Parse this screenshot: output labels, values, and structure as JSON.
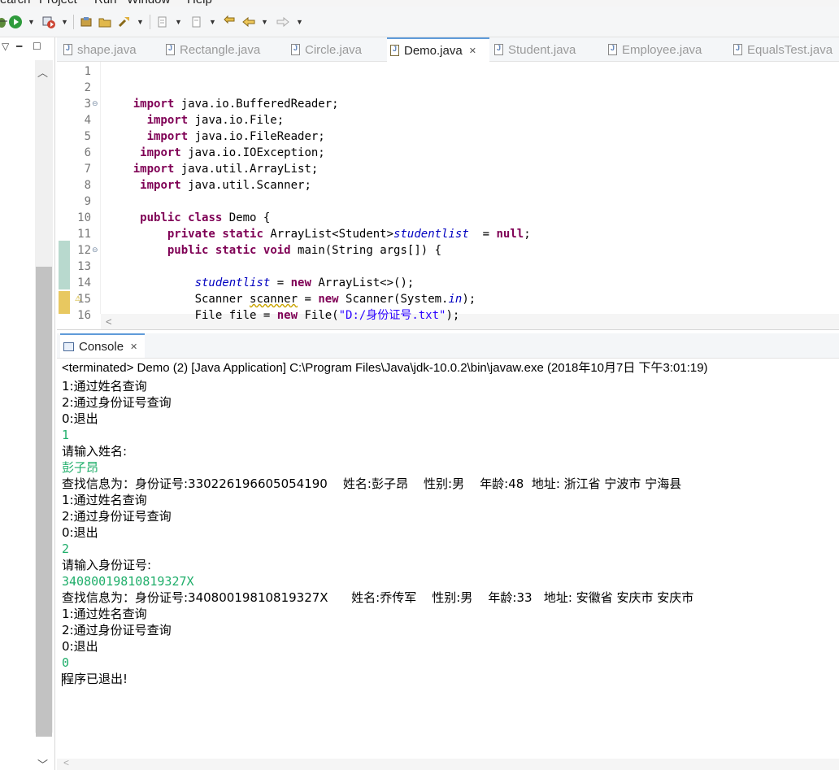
{
  "menubar": {
    "items": [
      "earch",
      "Project",
      "Run",
      "Window",
      "Help"
    ]
  },
  "tabs": [
    {
      "label": "shape.java",
      "active": false
    },
    {
      "label": "Rectangle.java",
      "active": false
    },
    {
      "label": "Circle.java",
      "active": false
    },
    {
      "label": "Demo.java",
      "active": true
    },
    {
      "label": "Student.java",
      "active": false
    },
    {
      "label": "Employee.java",
      "active": false
    },
    {
      "label": "EqualsTest.java",
      "active": false
    }
  ],
  "editor": {
    "line_numbers": [
      "1",
      "2",
      "3",
      "4",
      "5",
      "6",
      "7",
      "8",
      "9",
      "10",
      "11",
      "12",
      "13",
      "14",
      "15",
      "16"
    ],
    "lines": [
      {
        "indent": "",
        "parts": []
      },
      {
        "indent": "",
        "parts": []
      },
      {
        "indent": "    ",
        "parts": [
          {
            "t": "import",
            "c": "kw"
          },
          {
            "t": " java.io.BufferedReader;"
          }
        ]
      },
      {
        "indent": "      ",
        "parts": [
          {
            "t": "import",
            "c": "kw"
          },
          {
            "t": " java.io.File;"
          }
        ]
      },
      {
        "indent": "      ",
        "parts": [
          {
            "t": "import",
            "c": "kw"
          },
          {
            "t": " java.io.FileReader;"
          }
        ]
      },
      {
        "indent": "     ",
        "parts": [
          {
            "t": "import",
            "c": "kw"
          },
          {
            "t": " java.io.IOException;"
          }
        ]
      },
      {
        "indent": "    ",
        "parts": [
          {
            "t": "import",
            "c": "kw"
          },
          {
            "t": " java.util.ArrayList;"
          }
        ]
      },
      {
        "indent": "     ",
        "parts": [
          {
            "t": "import",
            "c": "kw"
          },
          {
            "t": " java.util.Scanner;"
          }
        ]
      },
      {
        "indent": "",
        "parts": []
      },
      {
        "indent": "     ",
        "parts": [
          {
            "t": "public",
            "c": "kw"
          },
          {
            "t": " "
          },
          {
            "t": "class",
            "c": "kw"
          },
          {
            "t": " Demo {"
          }
        ]
      },
      {
        "indent": "         ",
        "parts": [
          {
            "t": "private",
            "c": "kw"
          },
          {
            "t": " "
          },
          {
            "t": "static",
            "c": "kw"
          },
          {
            "t": " ArrayList<Student>"
          },
          {
            "t": "studentlist",
            "c": "fld"
          },
          {
            "t": "  = "
          },
          {
            "t": "null",
            "c": "kw"
          },
          {
            "t": ";"
          }
        ]
      },
      {
        "indent": "         ",
        "parts": [
          {
            "t": "public",
            "c": "kw"
          },
          {
            "t": " "
          },
          {
            "t": "static",
            "c": "kw"
          },
          {
            "t": " "
          },
          {
            "t": "void",
            "c": "kw"
          },
          {
            "t": " main(String "
          },
          {
            "t": "args",
            "c": "plain"
          },
          {
            "t": "[]) {"
          }
        ]
      },
      {
        "indent": "",
        "parts": []
      },
      {
        "indent": "             ",
        "parts": [
          {
            "t": "studentlist",
            "c": "fld"
          },
          {
            "t": " = "
          },
          {
            "t": "new",
            "c": "kw"
          },
          {
            "t": " ArrayList<>();"
          }
        ]
      },
      {
        "indent": "             ",
        "parts": [
          {
            "t": "Scanner "
          },
          {
            "t": "scanner",
            "c": "warnu"
          },
          {
            "t": " = "
          },
          {
            "t": "new",
            "c": "kw"
          },
          {
            "t": " Scanner(System."
          },
          {
            "t": "in",
            "c": "fld"
          },
          {
            "t": ");"
          }
        ]
      },
      {
        "indent": "             ",
        "parts": [
          {
            "t": "File file = "
          },
          {
            "t": "new",
            "c": "kw"
          },
          {
            "t": " File("
          },
          {
            "t": "\"D:/身份证号.txt\"",
            "c": "str"
          },
          {
            "t": ");"
          }
        ]
      }
    ]
  },
  "console": {
    "tab_label": "Console",
    "header": "<terminated> Demo (2) [Java Application] C:\\Program Files\\Java\\jdk-10.0.2\\bin\\javaw.exe (2018年10月7日 下午3:01:19)",
    "lines": [
      {
        "text": "1:通过姓名查询",
        "input": false
      },
      {
        "text": "2:通过身份证号查询",
        "input": false
      },
      {
        "text": "0:退出",
        "input": false
      },
      {
        "text": "1",
        "input": true
      },
      {
        "text": "请输入姓名:",
        "input": false
      },
      {
        "text": "彭子昂",
        "input": true
      },
      {
        "text": "查找信息为：身份证号:330226196605054190    姓名:彭子昂    性别:男    年龄:48  地址: 浙江省 宁波市 宁海县",
        "input": false
      },
      {
        "text": "1:通过姓名查询",
        "input": false
      },
      {
        "text": "2:通过身份证号查询",
        "input": false
      },
      {
        "text": "0:退出",
        "input": false
      },
      {
        "text": "2",
        "input": true
      },
      {
        "text": "请输入身份证号:",
        "input": false
      },
      {
        "text": "34080019810819327X",
        "input": true
      },
      {
        "text": "查找信息为：身份证号:34080019810819327X      姓名:乔传军    性别:男    年龄:33   地址: 安徽省 安庆市 安庆市",
        "input": false
      },
      {
        "text": "1:通过姓名查询",
        "input": false
      },
      {
        "text": "2:通过身份证号查询",
        "input": false
      },
      {
        "text": "0:退出",
        "input": false
      },
      {
        "text": "0",
        "input": true
      },
      {
        "text": "程序已退出!",
        "input": false
      }
    ]
  },
  "colors": {
    "keyword": "#7f0055",
    "field": "#0000c0",
    "string": "#2a00ff",
    "console_input": "#1fae6a",
    "active_tab_accent": "#5f9bd9"
  },
  "icons": {
    "toolbar": [
      "debug-icon",
      "run-icon",
      "run-config-icon",
      "new-package-icon",
      "open-folder-icon",
      "build-icon",
      "next-annotation-icon",
      "prev-annotation-icon",
      "back-icon",
      "forward-icon"
    ]
  }
}
